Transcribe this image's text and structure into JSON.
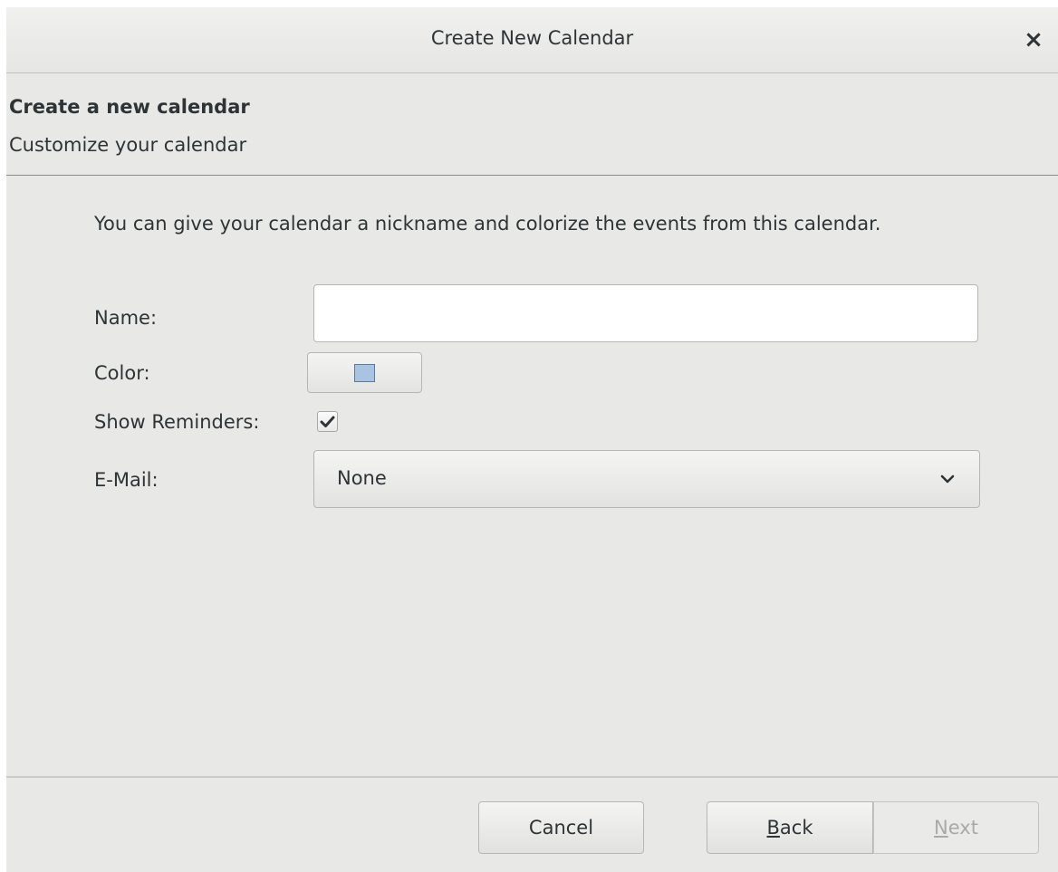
{
  "window": {
    "title": "Create New Calendar",
    "close_icon": "close-icon"
  },
  "header": {
    "title": "Create a new calendar",
    "subtitle": "Customize your calendar"
  },
  "form": {
    "description": "You can give your calendar a nickname and colorize the events from this calendar.",
    "name_label": "Name:",
    "name_value": "",
    "color_label": "Color:",
    "color_value": "#a8c4e0",
    "reminders_label": "Show Reminders:",
    "reminders_checked": true,
    "email_label": "E-Mail:",
    "email_value": "None"
  },
  "footer": {
    "cancel_label": "Cancel",
    "back_mnemonic": "B",
    "back_rest": "ack",
    "next_mnemonic": "N",
    "next_rest": "ext",
    "next_enabled": false
  }
}
